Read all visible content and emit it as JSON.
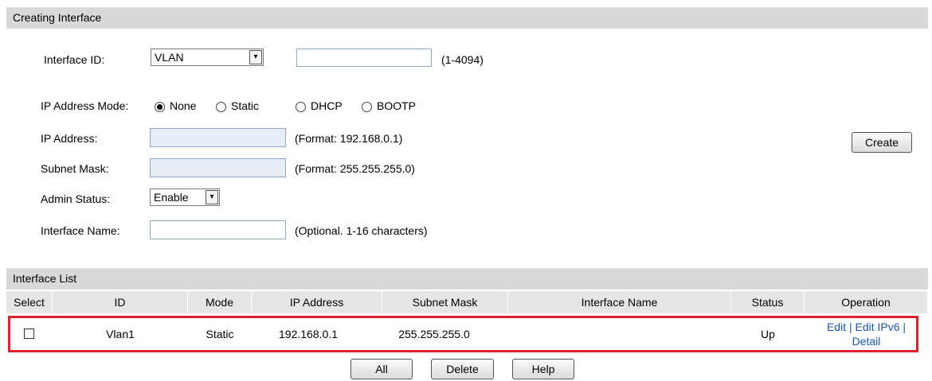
{
  "creating": {
    "header": "Creating Interface",
    "interface_id_label": "Interface ID:",
    "interface_id_type": "VLAN",
    "interface_id_value": "",
    "interface_id_hint": "(1-4094)",
    "ip_mode_label": "IP Address Mode:",
    "ip_modes": [
      {
        "label": "None",
        "checked": true
      },
      {
        "label": "Static",
        "checked": false
      },
      {
        "label": "DHCP",
        "checked": false
      },
      {
        "label": "BOOTP",
        "checked": false
      }
    ],
    "ip_address_label": "IP Address:",
    "ip_address_value": "",
    "ip_address_hint": "(Format: 192.168.0.1)",
    "subnet_mask_label": "Subnet Mask:",
    "subnet_mask_value": "",
    "subnet_mask_hint": "(Format: 255.255.255.0)",
    "admin_status_label": "Admin Status:",
    "admin_status_value": "Enable",
    "interface_name_label": "Interface Name:",
    "interface_name_value": "",
    "interface_name_hint": "(Optional. 1-16 characters)",
    "create_button": "Create",
    "dropdown_arrow": "▾"
  },
  "list": {
    "header": "Interface List",
    "columns": [
      "Select",
      "ID",
      "Mode",
      "IP Address",
      "Subnet Mask",
      "Interface Name",
      "Status",
      "Operation"
    ],
    "rows": [
      {
        "id": "Vlan1",
        "mode": "Static",
        "ip": "192.168.0.1",
        "mask": "255.255.255.0",
        "name": "",
        "status": "Up",
        "op_edit": "Edit",
        "op_sep1": " | ",
        "op_edit_ipv6": "Edit IPv6",
        "op_sep2": " |",
        "op_detail": "Detail",
        "selected": false
      }
    ],
    "buttons": {
      "all": "All",
      "delete": "Delete",
      "help": "Help"
    },
    "highlight_color": "#e0202a"
  }
}
